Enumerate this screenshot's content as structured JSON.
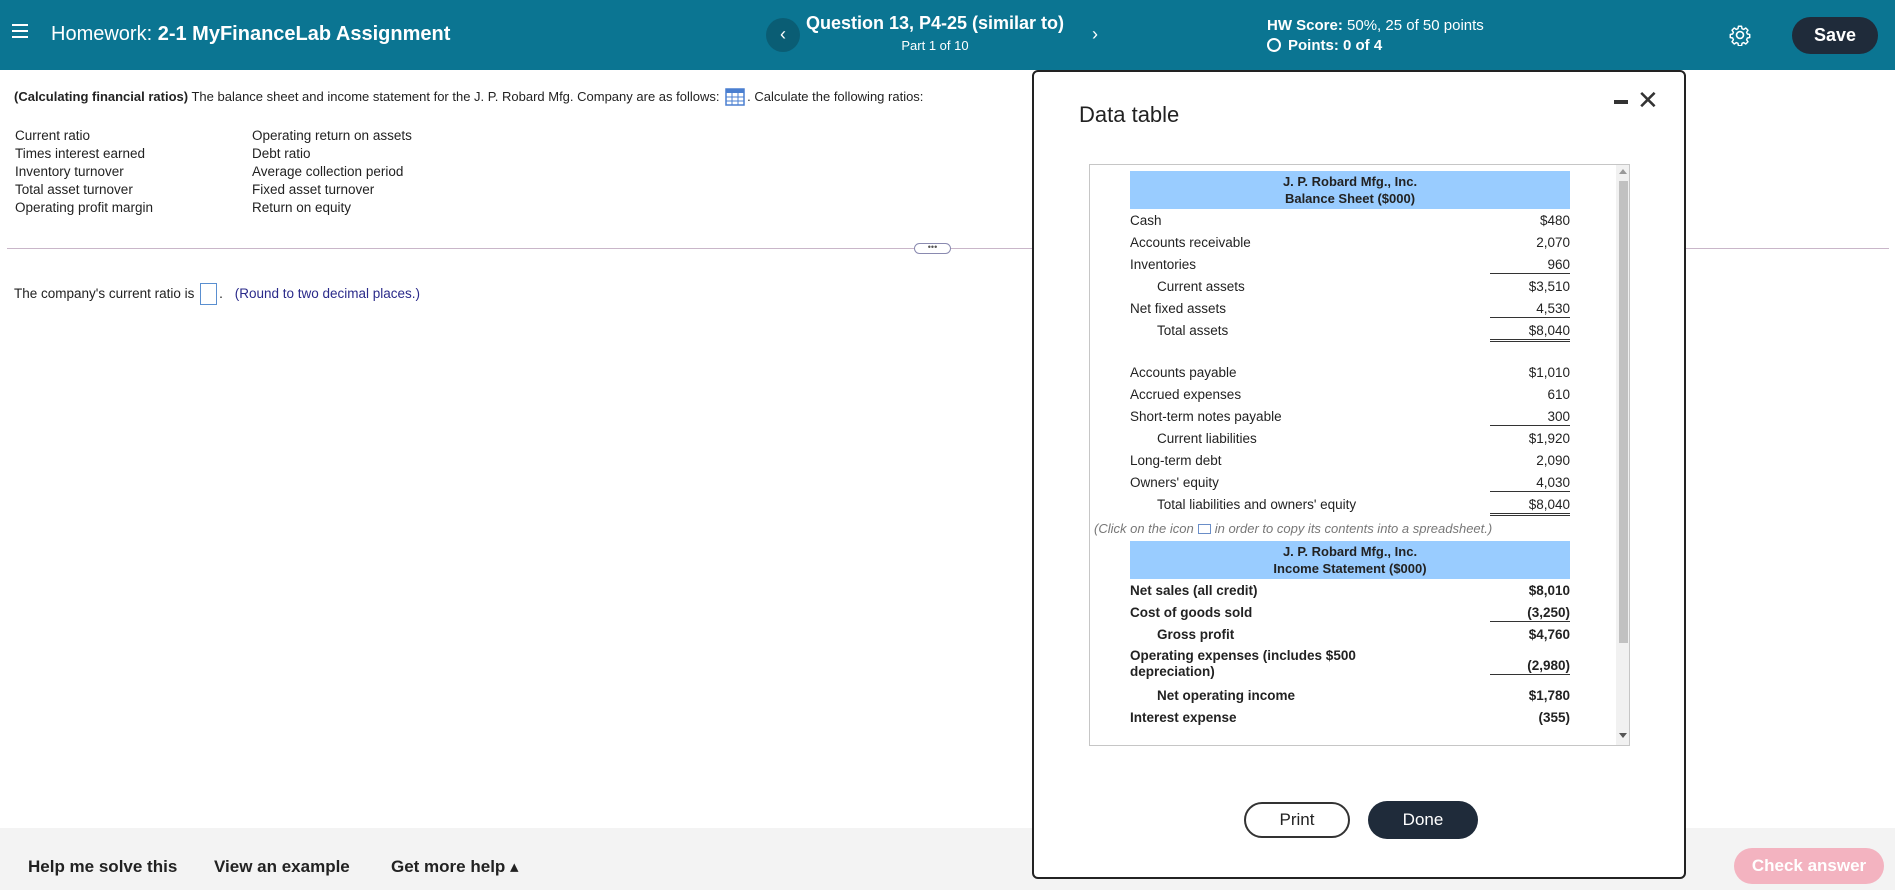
{
  "header": {
    "homework_prefix": "Homework:",
    "homework_title": "2-1 MyFinanceLab Assignment",
    "question_title": "Question 13, P4-25 (similar to)",
    "part_text": "Part 1 of 10",
    "prev_glyph": "‹",
    "next_glyph": "›",
    "score_label": "HW Score:",
    "score_value": "50%, 25 of 50 points",
    "points_text": "Points: 0 of 4",
    "save_label": "Save"
  },
  "question": {
    "topic": "(Calculating financial ratios)",
    "intro": "The balance sheet and income statement for the J. P. Robard Mfg. Company are as follows:",
    "instruction": ". Calculate the following ratios:",
    "ratios_col1": [
      "Current ratio",
      "Times interest earned",
      "Inventory turnover",
      "Total asset turnover",
      "Operating profit margin"
    ],
    "ratios_col2": [
      "Operating return on assets",
      "Debt ratio",
      "Average collection period",
      "Fixed asset turnover",
      "Return on equity"
    ],
    "answer_prefix": "The company's current ratio is",
    "answer_suffix": ".",
    "answer_hint": "(Round to two decimal places.)",
    "more_glyph": "•••"
  },
  "footer": {
    "help_label": "Help me solve this",
    "example_label": "View an example",
    "more_help_label": "Get more help ▴",
    "check_label": "Check answer"
  },
  "modal": {
    "title": "Data table",
    "close_glyph": "✕",
    "balance_sheet": {
      "company": "J. P. Robard Mfg., Inc.",
      "heading": "Balance Sheet ($000)",
      "assets": [
        {
          "label": "Cash",
          "value": "$480",
          "indent": false,
          "style": ""
        },
        {
          "label": "Accounts receivable",
          "value": "2,070",
          "indent": false,
          "style": ""
        },
        {
          "label": "Inventories",
          "value": "960",
          "indent": false,
          "style": "ul"
        },
        {
          "label": "Current assets",
          "value": "$3,510",
          "indent": true,
          "style": ""
        },
        {
          "label": "Net fixed assets",
          "value": "4,530",
          "indent": false,
          "style": "ul"
        },
        {
          "label": "Total assets",
          "value": "$8,040",
          "indent": true,
          "style": "dul"
        }
      ],
      "liabilities": [
        {
          "label": "Accounts payable",
          "value": "$1,010",
          "indent": false,
          "style": ""
        },
        {
          "label": "Accrued expenses",
          "value": "610",
          "indent": false,
          "style": ""
        },
        {
          "label": "Short-term notes payable",
          "value": "300",
          "indent": false,
          "style": "ul"
        },
        {
          "label": "Current liabilities",
          "value": "$1,920",
          "indent": true,
          "style": ""
        },
        {
          "label": "Long-term debt",
          "value": "2,090",
          "indent": false,
          "style": ""
        },
        {
          "label": "Owners' equity",
          "value": "4,030",
          "indent": false,
          "style": "ul"
        },
        {
          "label": "Total liabilities and owners' equity",
          "value": "$8,040",
          "indent": true,
          "style": "dul"
        }
      ]
    },
    "copy_note_prefix": "(Click on the icon",
    "copy_note_suffix": "in order to copy its contents into a spreadsheet.)",
    "income_statement": {
      "company": "J. P. Robard Mfg., Inc.",
      "heading": "Income Statement ($000)",
      "rows": [
        {
          "label": "Net sales (all credit)",
          "value": "$8,010",
          "indent": false,
          "style": ""
        },
        {
          "label": "Cost of goods sold",
          "value": "(3,250)",
          "indent": false,
          "style": "ul"
        },
        {
          "label": "Gross profit",
          "value": "$4,760",
          "indent": true,
          "style": ""
        },
        {
          "label": "Operating expenses (includes $500 depreciation)",
          "value": "(2,980)",
          "indent": false,
          "style": "ul",
          "tall": true
        },
        {
          "label": "Net operating income",
          "value": "$1,780",
          "indent": true,
          "style": ""
        },
        {
          "label": "Interest expense",
          "value": "(355)",
          "indent": false,
          "style": ""
        }
      ]
    },
    "print_label": "Print",
    "done_label": "Done"
  },
  "colors": {
    "header_bg": "#0b7592",
    "table_header_bg": "#99ccff",
    "save_bg": "#1f2b3a",
    "check_answer_bg": "#f3b3c0"
  }
}
